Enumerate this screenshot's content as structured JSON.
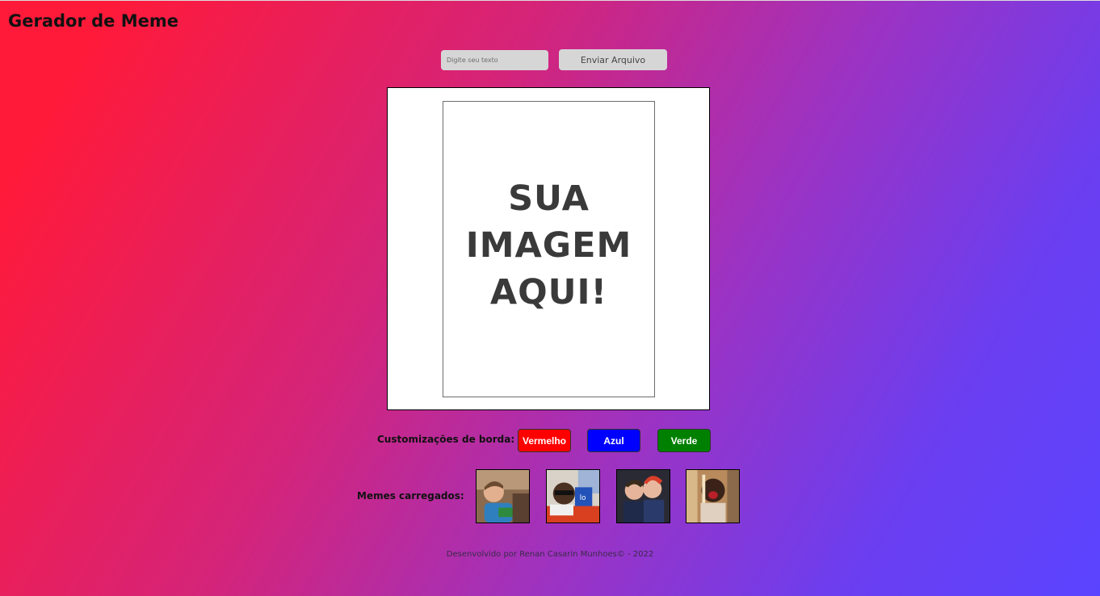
{
  "header": {
    "title": "Gerador de Meme"
  },
  "controls": {
    "text_input_placeholder": "Digite seu texto",
    "text_input_value": "",
    "upload_label": "Enviar Arquivo"
  },
  "meme": {
    "placeholder_text": "SUA\nIMAGEM\nAQUI!",
    "overlay_text": ""
  },
  "borders": {
    "label": "Customizações de borda:",
    "buttons": [
      {
        "label": "Vermelho",
        "color": "#ff0000"
      },
      {
        "label": "Azul",
        "color": "#0000ff"
      },
      {
        "label": "Verde",
        "color": "#008000"
      }
    ]
  },
  "loaded_memes": {
    "label": "Memes carregados:",
    "thumbnails": [
      "meme-thumbnail-1",
      "meme-thumbnail-2",
      "meme-thumbnail-3",
      "meme-thumbnail-4"
    ]
  },
  "footer": {
    "text": "Desenvolvido por Renan Casarin Munhoes© - 2022"
  }
}
